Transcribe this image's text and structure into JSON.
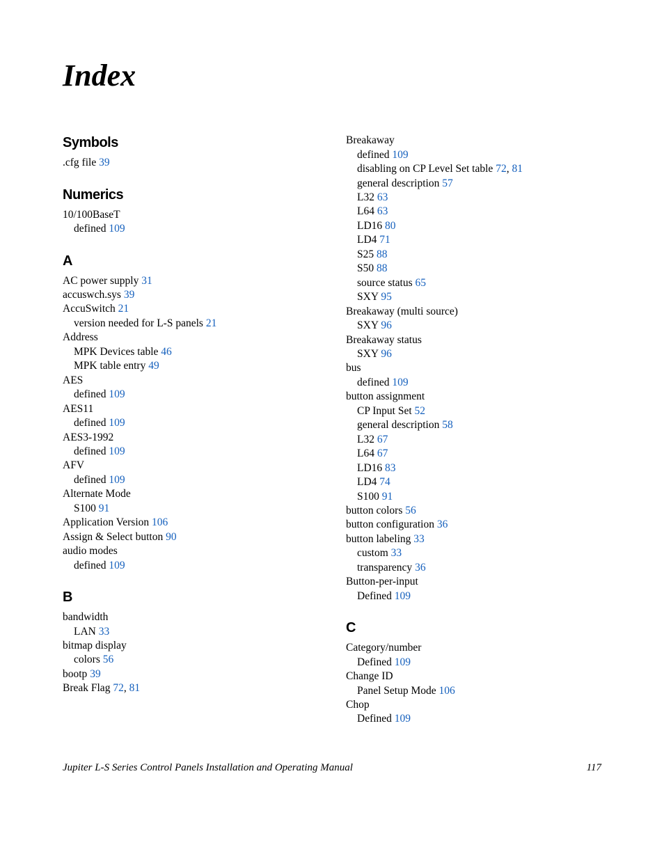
{
  "title": "Index",
  "footer": {
    "book_title": "Jupiter L-S Series Control Panels Installation and Operating Manual",
    "page_number": "117"
  },
  "columns": [
    {
      "sections": [
        {
          "heading": "Symbols",
          "entries": [
            {
              "text": ".cfg file",
              "pages": [
                "39"
              ],
              "level": 0
            }
          ]
        },
        {
          "heading": "Numerics",
          "entries": [
            {
              "text": "10/100BaseT",
              "pages": [],
              "level": 0
            },
            {
              "text": "defined",
              "pages": [
                "109"
              ],
              "level": 1
            }
          ]
        },
        {
          "heading": "A",
          "entries": [
            {
              "text": "AC power supply",
              "pages": [
                "31"
              ],
              "level": 0
            },
            {
              "text": "accuswch.sys",
              "pages": [
                "39"
              ],
              "level": 0
            },
            {
              "text": "AccuSwitch",
              "pages": [
                "21"
              ],
              "level": 0
            },
            {
              "text": "version needed for L-S panels",
              "pages": [
                "21"
              ],
              "level": 1
            },
            {
              "text": "Address",
              "pages": [],
              "level": 0
            },
            {
              "text": "MPK Devices table",
              "pages": [
                "46"
              ],
              "level": 1
            },
            {
              "text": "MPK table entry",
              "pages": [
                "49"
              ],
              "level": 1
            },
            {
              "text": "AES",
              "pages": [],
              "level": 0
            },
            {
              "text": "defined",
              "pages": [
                "109"
              ],
              "level": 1
            },
            {
              "text": "AES11",
              "pages": [],
              "level": 0
            },
            {
              "text": "defined",
              "pages": [
                "109"
              ],
              "level": 1
            },
            {
              "text": "AES3-1992",
              "pages": [],
              "level": 0
            },
            {
              "text": "defined",
              "pages": [
                "109"
              ],
              "level": 1
            },
            {
              "text": "AFV",
              "pages": [],
              "level": 0
            },
            {
              "text": "defined",
              "pages": [
                "109"
              ],
              "level": 1
            },
            {
              "text": "Alternate Mode",
              "pages": [],
              "level": 0
            },
            {
              "text": "S100",
              "pages": [
                "91"
              ],
              "level": 1
            },
            {
              "text": "Application Version",
              "pages": [
                "106"
              ],
              "level": 0
            },
            {
              "text": "Assign & Select button",
              "pages": [
                "90"
              ],
              "level": 0
            },
            {
              "text": "audio modes",
              "pages": [],
              "level": 0
            },
            {
              "text": "defined",
              "pages": [
                "109"
              ],
              "level": 1
            }
          ]
        },
        {
          "heading": "B",
          "entries": [
            {
              "text": "bandwidth",
              "pages": [],
              "level": 0
            },
            {
              "text": "LAN",
              "pages": [
                "33"
              ],
              "level": 1
            },
            {
              "text": "bitmap display",
              "pages": [],
              "level": 0
            },
            {
              "text": "colors",
              "pages": [
                "56"
              ],
              "level": 1
            },
            {
              "text": "bootp",
              "pages": [
                "39"
              ],
              "level": 0
            },
            {
              "text": "Break Flag",
              "pages": [
                "72",
                "81"
              ],
              "level": 0
            }
          ]
        }
      ]
    },
    {
      "sections": [
        {
          "heading": "",
          "entries": [
            {
              "text": "Breakaway",
              "pages": [],
              "level": 0
            },
            {
              "text": "defined",
              "pages": [
                "109"
              ],
              "level": 1
            },
            {
              "text": "disabling on CP Level Set table",
              "pages": [
                "72",
                "81"
              ],
              "level": 1
            },
            {
              "text": "general description",
              "pages": [
                "57"
              ],
              "level": 1
            },
            {
              "text": "L32",
              "pages": [
                "63"
              ],
              "level": 1
            },
            {
              "text": "L64",
              "pages": [
                "63"
              ],
              "level": 1
            },
            {
              "text": "LD16",
              "pages": [
                "80"
              ],
              "level": 1
            },
            {
              "text": "LD4",
              "pages": [
                "71"
              ],
              "level": 1
            },
            {
              "text": "S25",
              "pages": [
                "88"
              ],
              "level": 1
            },
            {
              "text": "S50",
              "pages": [
                "88"
              ],
              "level": 1
            },
            {
              "text": "source status",
              "pages": [
                "65"
              ],
              "level": 1
            },
            {
              "text": "SXY",
              "pages": [
                "95"
              ],
              "level": 1
            },
            {
              "text": "Breakaway (multi source)",
              "pages": [],
              "level": 0
            },
            {
              "text": "SXY",
              "pages": [
                "96"
              ],
              "level": 1
            },
            {
              "text": "Breakaway status",
              "pages": [],
              "level": 0
            },
            {
              "text": "SXY",
              "pages": [
                "96"
              ],
              "level": 1
            },
            {
              "text": "bus",
              "pages": [],
              "level": 0
            },
            {
              "text": "defined",
              "pages": [
                "109"
              ],
              "level": 1
            },
            {
              "text": "button assignment",
              "pages": [],
              "level": 0
            },
            {
              "text": "CP Input Set",
              "pages": [
                "52"
              ],
              "level": 1
            },
            {
              "text": "general description",
              "pages": [
                "58"
              ],
              "level": 1
            },
            {
              "text": "L32",
              "pages": [
                "67"
              ],
              "level": 1
            },
            {
              "text": "L64",
              "pages": [
                "67"
              ],
              "level": 1
            },
            {
              "text": "LD16",
              "pages": [
                "83"
              ],
              "level": 1
            },
            {
              "text": "LD4",
              "pages": [
                "74"
              ],
              "level": 1
            },
            {
              "text": "S100",
              "pages": [
                "91"
              ],
              "level": 1
            },
            {
              "text": "button colors",
              "pages": [
                "56"
              ],
              "level": 0
            },
            {
              "text": "button configuration",
              "pages": [
                "36"
              ],
              "level": 0
            },
            {
              "text": "button labeling",
              "pages": [
                "33"
              ],
              "level": 0
            },
            {
              "text": "custom",
              "pages": [
                "33"
              ],
              "level": 1
            },
            {
              "text": "transparency",
              "pages": [
                "36"
              ],
              "level": 1
            },
            {
              "text": "Button-per-input",
              "pages": [],
              "level": 0
            },
            {
              "text": "Defined",
              "pages": [
                "109"
              ],
              "level": 1
            }
          ]
        },
        {
          "heading": "C",
          "entries": [
            {
              "text": "Category/number",
              "pages": [],
              "level": 0
            },
            {
              "text": "Defined",
              "pages": [
                "109"
              ],
              "level": 1
            },
            {
              "text": "Change ID",
              "pages": [],
              "level": 0
            },
            {
              "text": "Panel Setup Mode",
              "pages": [
                "106"
              ],
              "level": 1
            },
            {
              "text": "Chop",
              "pages": [],
              "level": 0
            },
            {
              "text": "Defined",
              "pages": [
                "109"
              ],
              "level": 1
            }
          ]
        }
      ]
    }
  ]
}
